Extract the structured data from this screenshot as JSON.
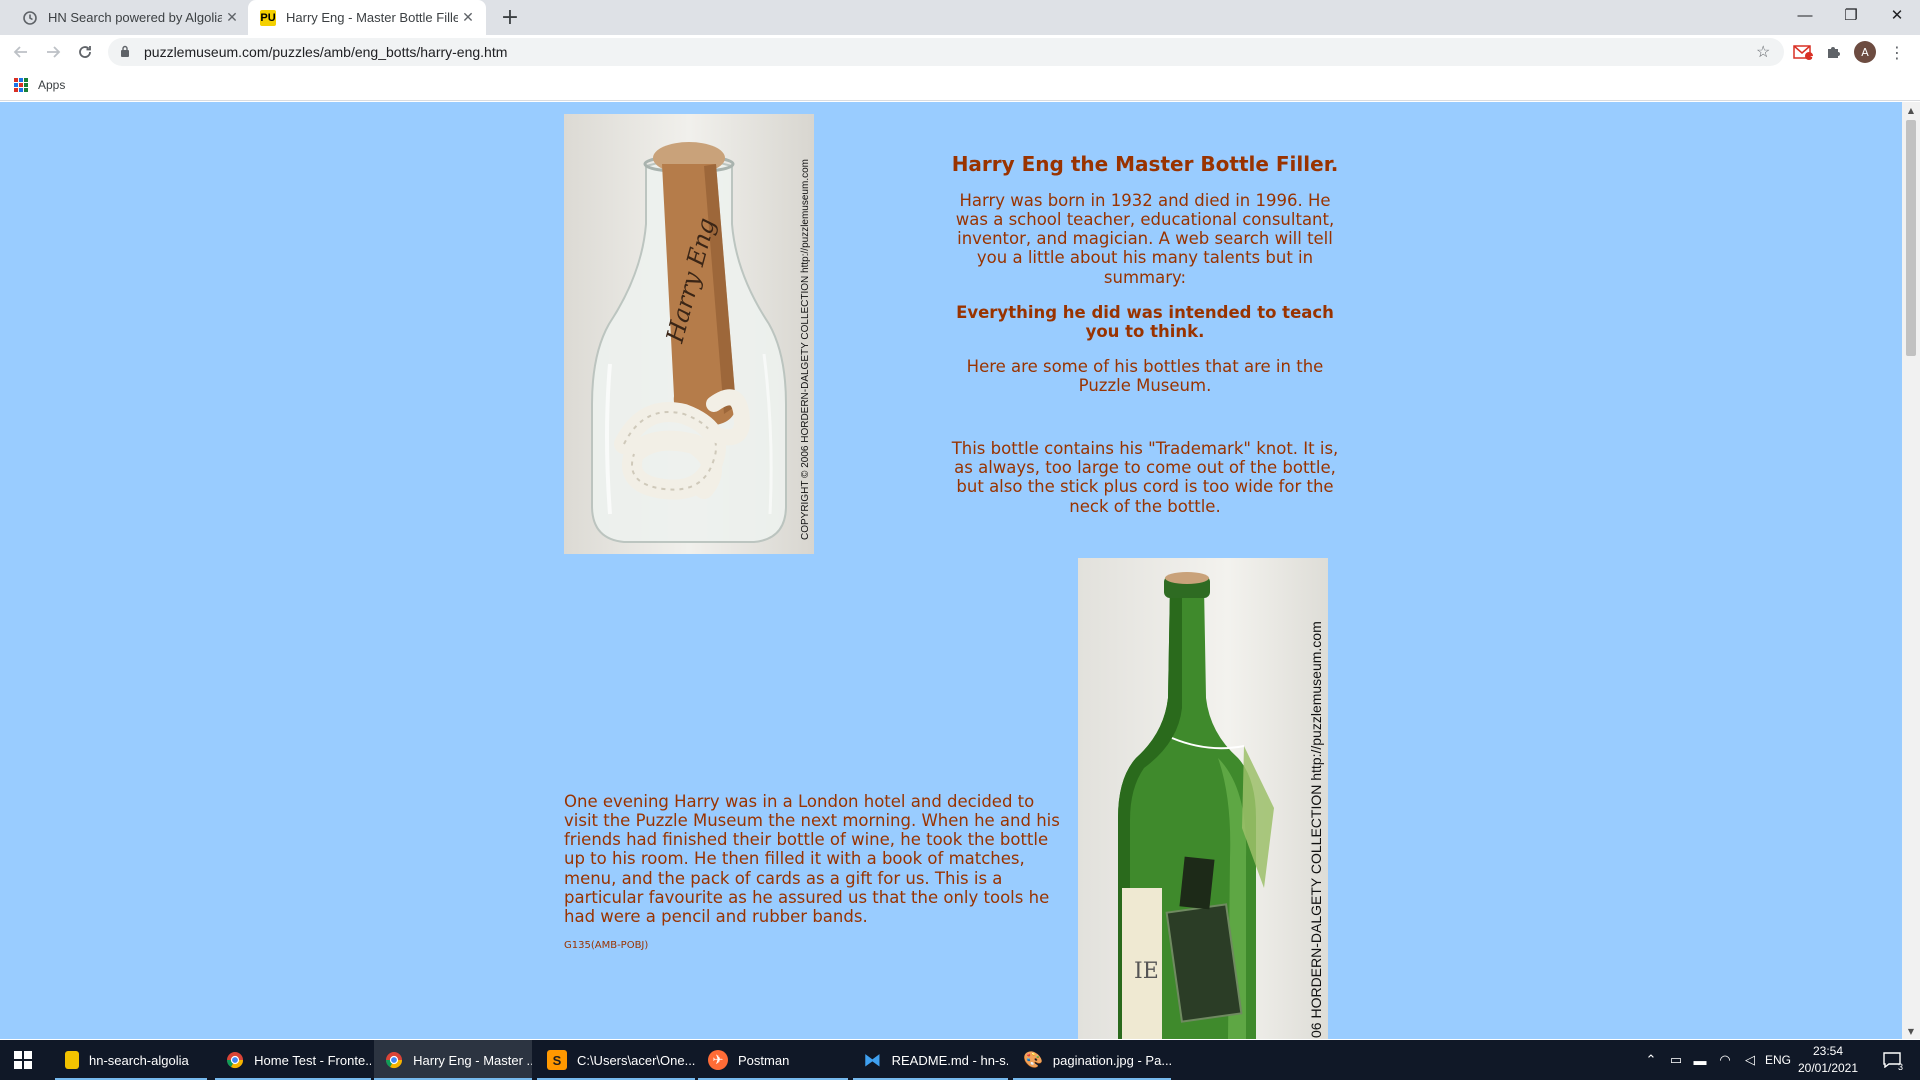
{
  "browser": {
    "tabs": [
      {
        "title": "HN Search powered by Algolia",
        "icon": "algolia-icon",
        "active": false
      },
      {
        "title": "Harry Eng - Master Bottle Filler",
        "icon": "puzzle-museum-icon",
        "active": true
      }
    ],
    "close_glyph": "✕",
    "new_tab_glyph": "+",
    "window_controls": {
      "minimize": "—",
      "restore": "❐",
      "close": "✕"
    },
    "url": "puzzlemuseum.com/puzzles/amb/eng_botts/harry-eng.htm",
    "bookmarks_apps_label": "Apps",
    "notification_badge": "1",
    "avatar_initial": "A"
  },
  "page": {
    "background_color": "#99ccff",
    "text_color": "#993300",
    "title": "Harry Eng the Master Bottle Filler.",
    "bio": "Harry was born in 1932 and died in 1996. He was a school teacher, educational consultant, inventor, and magician. A web search will tell you a little about his many talents but in summary:",
    "motto": "Everything he did was intended to teach you to think.",
    "intro": "Here are some of his bottles that are in the Puzzle Museum.",
    "bottle1_caption": "This bottle contains his \"Trademark\" knot. It is, as always, too large to come out of the bottle, but also the stick plus cord is too wide for the neck of the bottle.",
    "bottle2_caption": "One evening Harry was in a London hotel and decided to visit the Puzzle Museum the next morning. When he and his friends had finished their bottle of wine, he took the bottle up to his room. He then filled it with a book of matches, menu, and the pack of cards as a gift for us. This is a particular favourite as he assured us that the only tools he had were a pencil and rubber bands.",
    "catalogue_ref": "G135(AMB-POBJ)",
    "photo1_copyright": "COPYRIGHT © 2006 HORDERN-DALGETY COLLECTION http://puzzlemuseum.com",
    "photo1_stick_signature": "Harry Eng",
    "photo2_copyright": "06 HORDERN-DALGETY COLLECTION http://puzzlemuseum.com"
  },
  "taskbar": {
    "items": [
      {
        "label": "hn-search-algolia",
        "icon": "folder-icon",
        "active": false
      },
      {
        "label": "Home Test - Fronte...",
        "icon": "chrome-icon",
        "active": false
      },
      {
        "label": "Harry Eng - Master ...",
        "icon": "chrome-icon",
        "active": true
      },
      {
        "label": "C:\\Users\\acer\\One...",
        "icon": "sublime-icon",
        "active": false
      },
      {
        "label": "Postman",
        "icon": "postman-icon",
        "active": false
      },
      {
        "label": "README.md - hn-s...",
        "icon": "vscode-icon",
        "active": false
      },
      {
        "label": "pagination.jpg - Pa...",
        "icon": "paint-icon",
        "active": false
      }
    ],
    "language": "ENG",
    "time": "23:54",
    "date": "20/01/2021",
    "notification_count": "3"
  }
}
